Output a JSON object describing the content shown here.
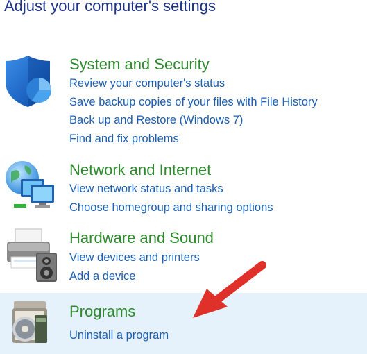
{
  "page": {
    "title": "Adjust your computer's settings"
  },
  "categories": [
    {
      "heading": "System and Security",
      "icon": "shield-icon",
      "links": [
        "Review your computer's status",
        "Save backup copies of your files with File History",
        "Back up and Restore (Windows 7)",
        "Find and fix problems"
      ]
    },
    {
      "heading": "Network and Internet",
      "icon": "network-globe-icon",
      "links": [
        "View network status and tasks",
        "Choose homegroup and sharing options"
      ]
    },
    {
      "heading": "Hardware and Sound",
      "icon": "printer-speaker-icon",
      "links": [
        "View devices and printers",
        "Add a device"
      ]
    },
    {
      "heading": "Programs",
      "icon": "programs-disc-icon",
      "highlighted": true,
      "links": [
        "Uninstall a program"
      ]
    }
  ],
  "annotation": {
    "icon": "red-arrow-icon",
    "color": "#e0302a"
  },
  "colors": {
    "title": "#1e3287",
    "heading": "#2d8a2d",
    "link": "#1a5fb4",
    "highlight": "#e5f1fb"
  }
}
